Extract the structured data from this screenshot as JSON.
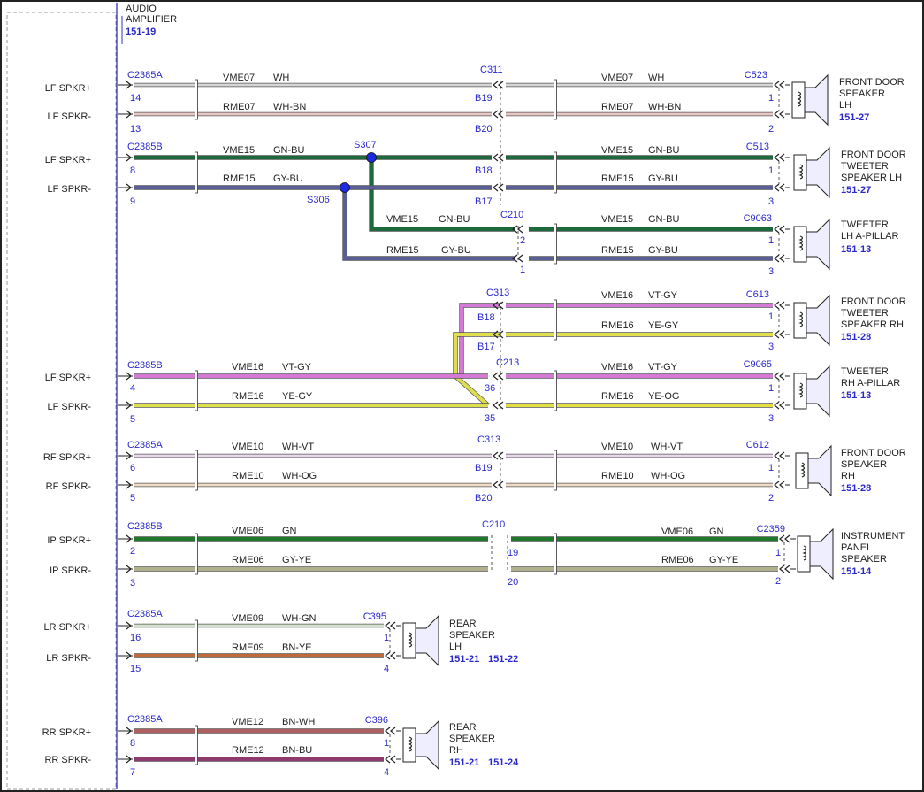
{
  "amplifier": {
    "title_line1": "AUDIO",
    "title_line2": "AMPLIFIER",
    "ref": "151-19"
  },
  "pins": [
    {
      "label": "LF SPKR+"
    },
    {
      "label": "LF SPKR-"
    },
    {
      "label": "LF SPKR+"
    },
    {
      "label": "LF SPKR-"
    },
    {
      "label": "LF SPKR+"
    },
    {
      "label": "LF SPKR-"
    },
    {
      "label": "RF SPKR+"
    },
    {
      "label": "RF SPKR-"
    },
    {
      "label": "IP SPKR+"
    },
    {
      "label": "IP SPKR-"
    },
    {
      "label": "LR SPKR+"
    },
    {
      "label": "LR SPKR-"
    },
    {
      "label": "RR SPKR+"
    },
    {
      "label": "RR SPKR-"
    }
  ],
  "amp_connectors": [
    "C2385A",
    "C2385B",
    "C2385B",
    "C2385A",
    "C2385B",
    "C2385A",
    "C2385A"
  ],
  "amp_pins": [
    "14",
    "13",
    "8",
    "9",
    "4",
    "5",
    "6",
    "5",
    "2",
    "3",
    "16",
    "15",
    "8",
    "7"
  ],
  "splices": [
    "S307",
    "S306"
  ],
  "inline_connectors": [
    "C311",
    "C313",
    "C213",
    "C313",
    "C210",
    "C210"
  ],
  "inline_pins": [
    "B19",
    "B20",
    "B18",
    "B17",
    "2",
    "1",
    "B18",
    "B17",
    "36",
    "35",
    "B19",
    "B20",
    "19",
    "20"
  ],
  "wires": [
    {
      "circuit": "VME07",
      "color": "WH"
    },
    {
      "circuit": "RME07",
      "color": "WH-BN"
    },
    {
      "circuit": "VME15",
      "color": "GN-BU"
    },
    {
      "circuit": "RME15",
      "color": "GY-BU"
    },
    {
      "circuit": "VME16",
      "color": "VT-GY"
    },
    {
      "circuit": "RME16",
      "color": "YE-GY"
    },
    {
      "circuit": "VME10",
      "color": "WH-VT"
    },
    {
      "circuit": "RME10",
      "color": "WH-OG"
    },
    {
      "circuit": "VME06",
      "color": "GN"
    },
    {
      "circuit": "RME06",
      "color": "GY-YE"
    },
    {
      "circuit": "VME09",
      "color": "WH-GN"
    },
    {
      "circuit": "RME09",
      "color": "BN-YE"
    },
    {
      "circuit": "VME12",
      "color": "BN-WH"
    },
    {
      "circuit": "RME12",
      "color": "BN-BU"
    },
    {
      "circuit": "VME07",
      "color": "WH"
    },
    {
      "circuit": "RME07",
      "color": "WH-BN"
    },
    {
      "circuit": "VME15",
      "color": "GN-BU"
    },
    {
      "circuit": "RME15",
      "color": "GY-BU"
    },
    {
      "circuit": "VME15",
      "color": "GN-BU"
    },
    {
      "circuit": "RME15",
      "color": "GY-BU"
    },
    {
      "circuit": "VME15",
      "color": "GN-BU"
    },
    {
      "circuit": "RME15",
      "color": "GY-BU"
    },
    {
      "circuit": "VME16",
      "color": "VT-GY"
    },
    {
      "circuit": "RME16",
      "color": "YE-GY"
    },
    {
      "circuit": "VME16",
      "color": "VT-GY"
    },
    {
      "circuit": "RME16",
      "color": "YE-OG"
    },
    {
      "circuit": "VME10",
      "color": "WH-VT"
    },
    {
      "circuit": "RME10",
      "color": "WH-OG"
    },
    {
      "circuit": "VME06",
      "color": "GN"
    },
    {
      "circuit": "RME06",
      "color": "GY-YE"
    }
  ],
  "speakers": [
    {
      "connector": "C523",
      "pin_a": "1",
      "pin_b": "2",
      "name_lines": [
        "FRONT DOOR",
        "SPEAKER",
        "LH"
      ],
      "refs": [
        "151-27"
      ]
    },
    {
      "connector": "C513",
      "pin_a": "1",
      "pin_b": "3",
      "name_lines": [
        "FRONT DOOR",
        "TWEETER",
        "SPEAKER LH"
      ],
      "refs": [
        "151-27"
      ]
    },
    {
      "connector": "C9063",
      "pin_a": "1",
      "pin_b": "3",
      "name_lines": [
        "TWEETER",
        "LH A-PILLAR"
      ],
      "refs": [
        "151-13"
      ]
    },
    {
      "connector": "C613",
      "pin_a": "1",
      "pin_b": "3",
      "name_lines": [
        "FRONT DOOR",
        "TWEETER",
        "SPEAKER RH"
      ],
      "refs": [
        "151-28"
      ]
    },
    {
      "connector": "C9065",
      "pin_a": "1",
      "pin_b": "3",
      "name_lines": [
        "TWEETER",
        "RH A-PILLAR"
      ],
      "refs": [
        "151-13"
      ]
    },
    {
      "connector": "C612",
      "pin_a": "1",
      "pin_b": "2",
      "name_lines": [
        "FRONT DOOR",
        "SPEAKER",
        "RH"
      ],
      "refs": [
        "151-28"
      ]
    },
    {
      "connector": "C2359",
      "pin_a": "1",
      "pin_b": "2",
      "name_lines": [
        "INSTRUMENT",
        "PANEL",
        "SPEAKER"
      ],
      "refs": [
        "151-14"
      ]
    },
    {
      "connector": "C395",
      "pin_a": "1",
      "pin_b": "4",
      "name_lines": [
        "REAR",
        "SPEAKER",
        "LH"
      ],
      "refs": [
        "151-21",
        "151-22"
      ]
    },
    {
      "connector": "C396",
      "pin_a": "1",
      "pin_b": "4",
      "name_lines": [
        "REAR",
        "SPEAKER",
        "RH"
      ],
      "refs": [
        "151-21",
        "151-24"
      ]
    }
  ],
  "colors": {
    "WH": "#d6d6d6",
    "WH-BN": "#e8c8c4",
    "GN-BU": "#1c6a3c",
    "GY-BU": "#5a5e96",
    "VT-GY": "#d27ad4",
    "YE-GY": "#dede4e",
    "YE-OG": "#e2de44",
    "WH-VT": "#e8d8ea",
    "WH-OG": "#f0dcc4",
    "GN": "#1e7a2a",
    "GY-YE": "#b0b08a",
    "WH-GN": "#d2e2cc",
    "BN-YE": "#c06a3c",
    "BN-WH": "#b06060",
    "BN-BU": "#8e3a6e",
    "label_blue": "#2a2acc",
    "frame": "#2a2acc"
  }
}
